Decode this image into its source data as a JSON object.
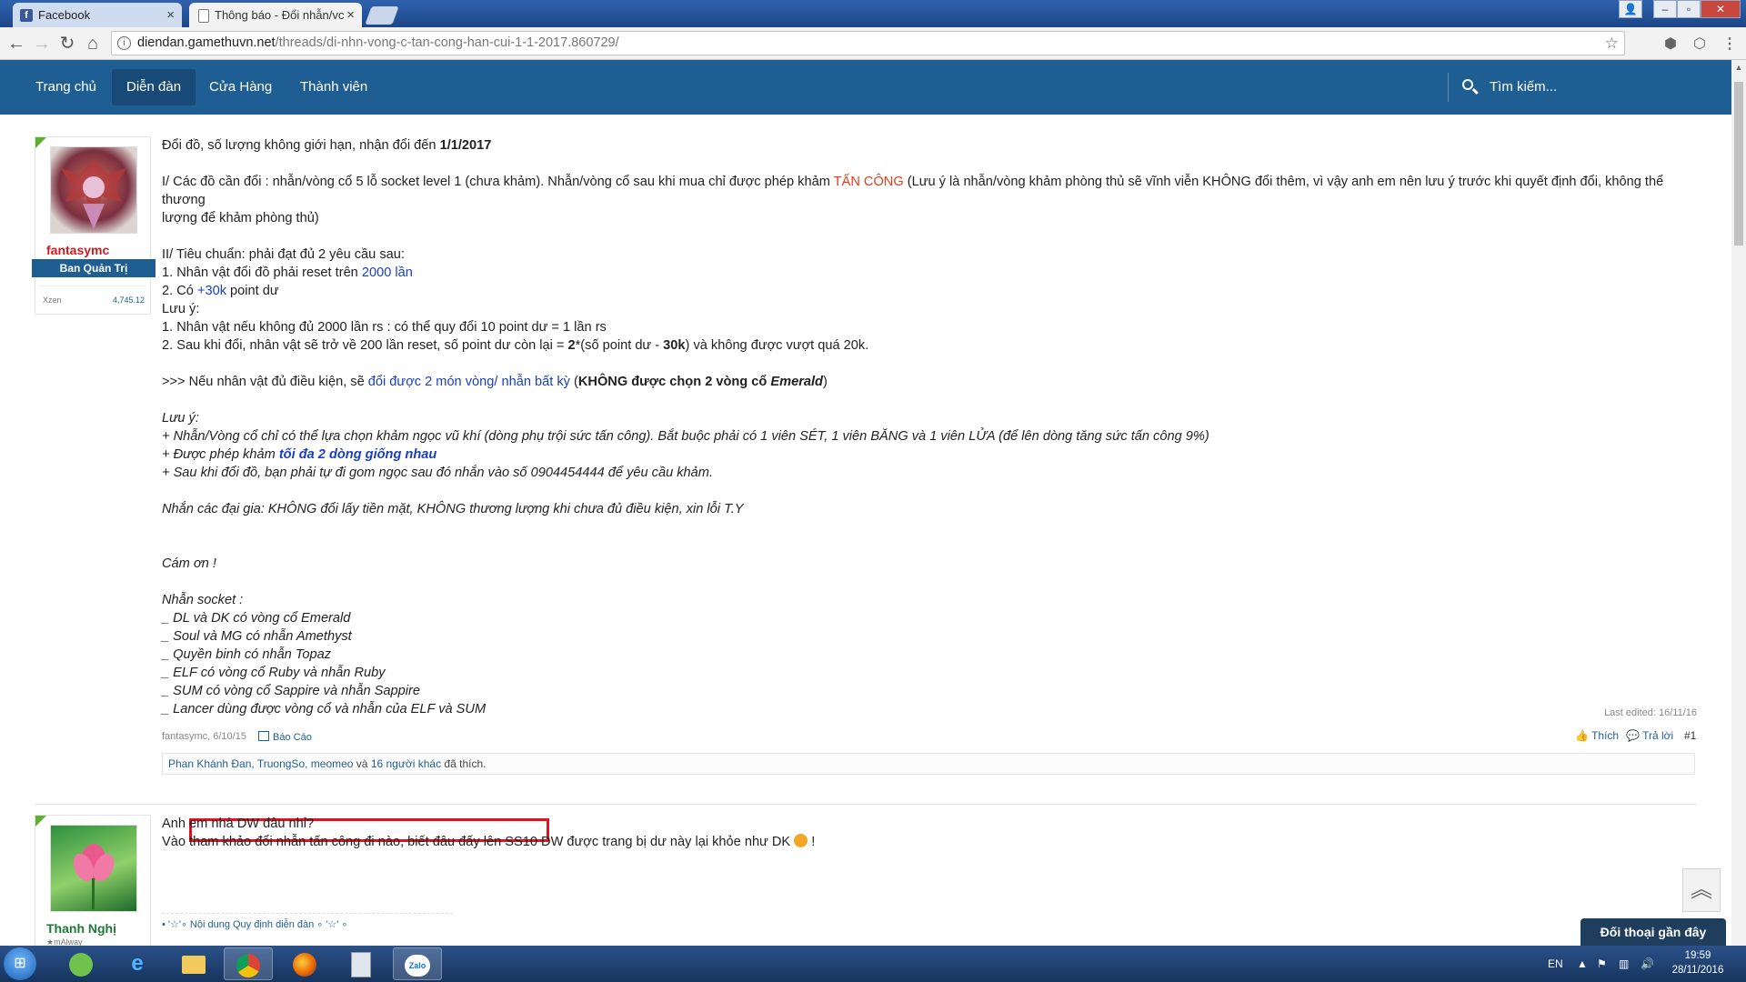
{
  "browser": {
    "tabs": [
      {
        "title": "Facebook",
        "active": false
      },
      {
        "title": "Thông báo - Đổi nhẫn/vc",
        "active": true
      }
    ],
    "url_domain": "diendan.gamethuvn.net",
    "url_path": "/threads/di-nhn-vong-c-tan-cong-han-cui-1-1-2017.860729/"
  },
  "site_nav": {
    "items": [
      "Trang chủ",
      "Diễn đàn",
      "Cửa Hàng",
      "Thành viên"
    ],
    "selected": "Diễn đàn",
    "search_placeholder": "Tìm kiếm..."
  },
  "post1": {
    "user": {
      "name": "fantasymc",
      "role": "Ban Quản Trị",
      "stat_label": "Xzen",
      "stat_value": "4,745.12"
    },
    "lines": {
      "l1a": "Đổi đồ, số lượng không giới hạn, nhận đổi đến ",
      "l1b": "1/1/2017",
      "l2a": "I/ Các đồ cần đổi : nhẫn/vòng cổ 5 lỗ socket level 1 (chưa khảm). Nhẫn/vòng cổ sau khi mua chỉ được phép khảm ",
      "l2b": "TẤN CÔNG",
      "l2c": " (Lưu ý là nhẫn/vòng khảm phòng thủ sẽ vĩnh viễn KHÔNG đổi thêm, vì vậy anh em nên lưu ý trước khi quyết định đổi, không thể thương",
      "l3": "lượng để khảm phòng thủ)",
      "l4": "II/ Tiêu chuẩn: phải đạt đủ 2 yêu cầu sau:",
      "l5a": "1. Nhân vật đổi đồ phải reset trên ",
      "l5b": "2000 lần",
      "l6a": "2. Có ",
      "l6b": "+30k",
      "l6c": " point dư",
      "l7": "Lưu ý:",
      "l8": "1. Nhân vật nếu không đủ 2000 lần rs : có thể quy đổi 10 point dư = 1 lần rs",
      "l9a": "2. Sau khi đổi, nhân vật sẽ trở về 200 lần reset, số point dư còn lại = ",
      "l9b": "2",
      "l9c": "*(số point dư - ",
      "l9d": "30k",
      "l9e": ") và không được vượt quá 20k.",
      "l10a": ">>> Nếu nhân vật đủ điều kiện, sẽ ",
      "l10b": "đổi được 2 món vòng/ nhẫn bất kỳ",
      "l10c": " (",
      "l10d": "KHÔNG được chọn 2 vòng cổ ",
      "l10e": "Emerald",
      "l10f": ")",
      "l11": "Lưu ý:",
      "l12": "+ Nhẫn/Vòng cổ chỉ có thể lựa chọn khảm ngọc vũ khí (dòng phụ trội sức tấn công). Bắt buộc phải có 1 viên SÉT, 1 viên BĂNG và 1 viên LỬA (để lên dòng tăng sức tấn công 9%)",
      "l13a": "+ Được phép khảm ",
      "l13b": "tối đa 2 dòng giống nhau",
      "l14": "+ Sau khi đổi đồ, bạn phải tự đi gom ngọc sau đó nhắn vào số 0904454444 để yêu cầu khảm.",
      "l15": "Nhắn các đại gia: KHÔNG đổi lấy tiền mặt, KHÔNG thương lượng khi chưa đủ điều kiện, xin lỗi T.Y",
      "l16": "Cám ơn !",
      "l17": "Nhẫn socket :",
      "l18": "_ DL và DK có vòng cổ Emerald",
      "l19": "_ Soul và MG có nhẫn Amethyst",
      "l20": "_ Quyền binh có nhẫn Topaz",
      "l21": "_ ELF có vòng cổ Ruby và nhẫn Ruby",
      "l22": "_ SUM có vòng cổ Sappire và nhẫn Sappire",
      "l23": "_ Lancer dùng được vòng cổ và nhẫn của ELF và SUM"
    },
    "last_edited": "Last edited: 16/11/16",
    "meta_author": "fantasymc, 6/10/15",
    "report": "Báo Cáo",
    "like": "Thích",
    "reply": "Trả lời",
    "post_number": "#1",
    "likes_names": "Phan Khánh Đan, TruongSo, meomeo",
    "likes_and": " và ",
    "likes_others": "16 người khác",
    "likes_suffix": " đã thích."
  },
  "post2": {
    "user": {
      "name": "Thanh Nghị",
      "title": "★mAlway"
    },
    "line1": "Anh em nhà DW đâu nhỉ?",
    "line2": "Vào tham khảo đổi nhẫn tấn công đi nào, biết đâu đấy lên SS10 DW được trang bị dư này lại khỏe như DK",
    "line2_end": "!",
    "signature": "• '☆'∘ Nội dung Quy định diễn đàn ∘ '☆' ∘"
  },
  "chat_button": "Đối thoại gần đây",
  "taskbar": {
    "lang": "EN",
    "time": "19:59",
    "date": "28/11/2016"
  },
  "colors": {
    "nav": "#1f5e93",
    "highlight": "#e0121f",
    "red_text": "#e23b1a",
    "blue_text": "#1a3fbe"
  }
}
